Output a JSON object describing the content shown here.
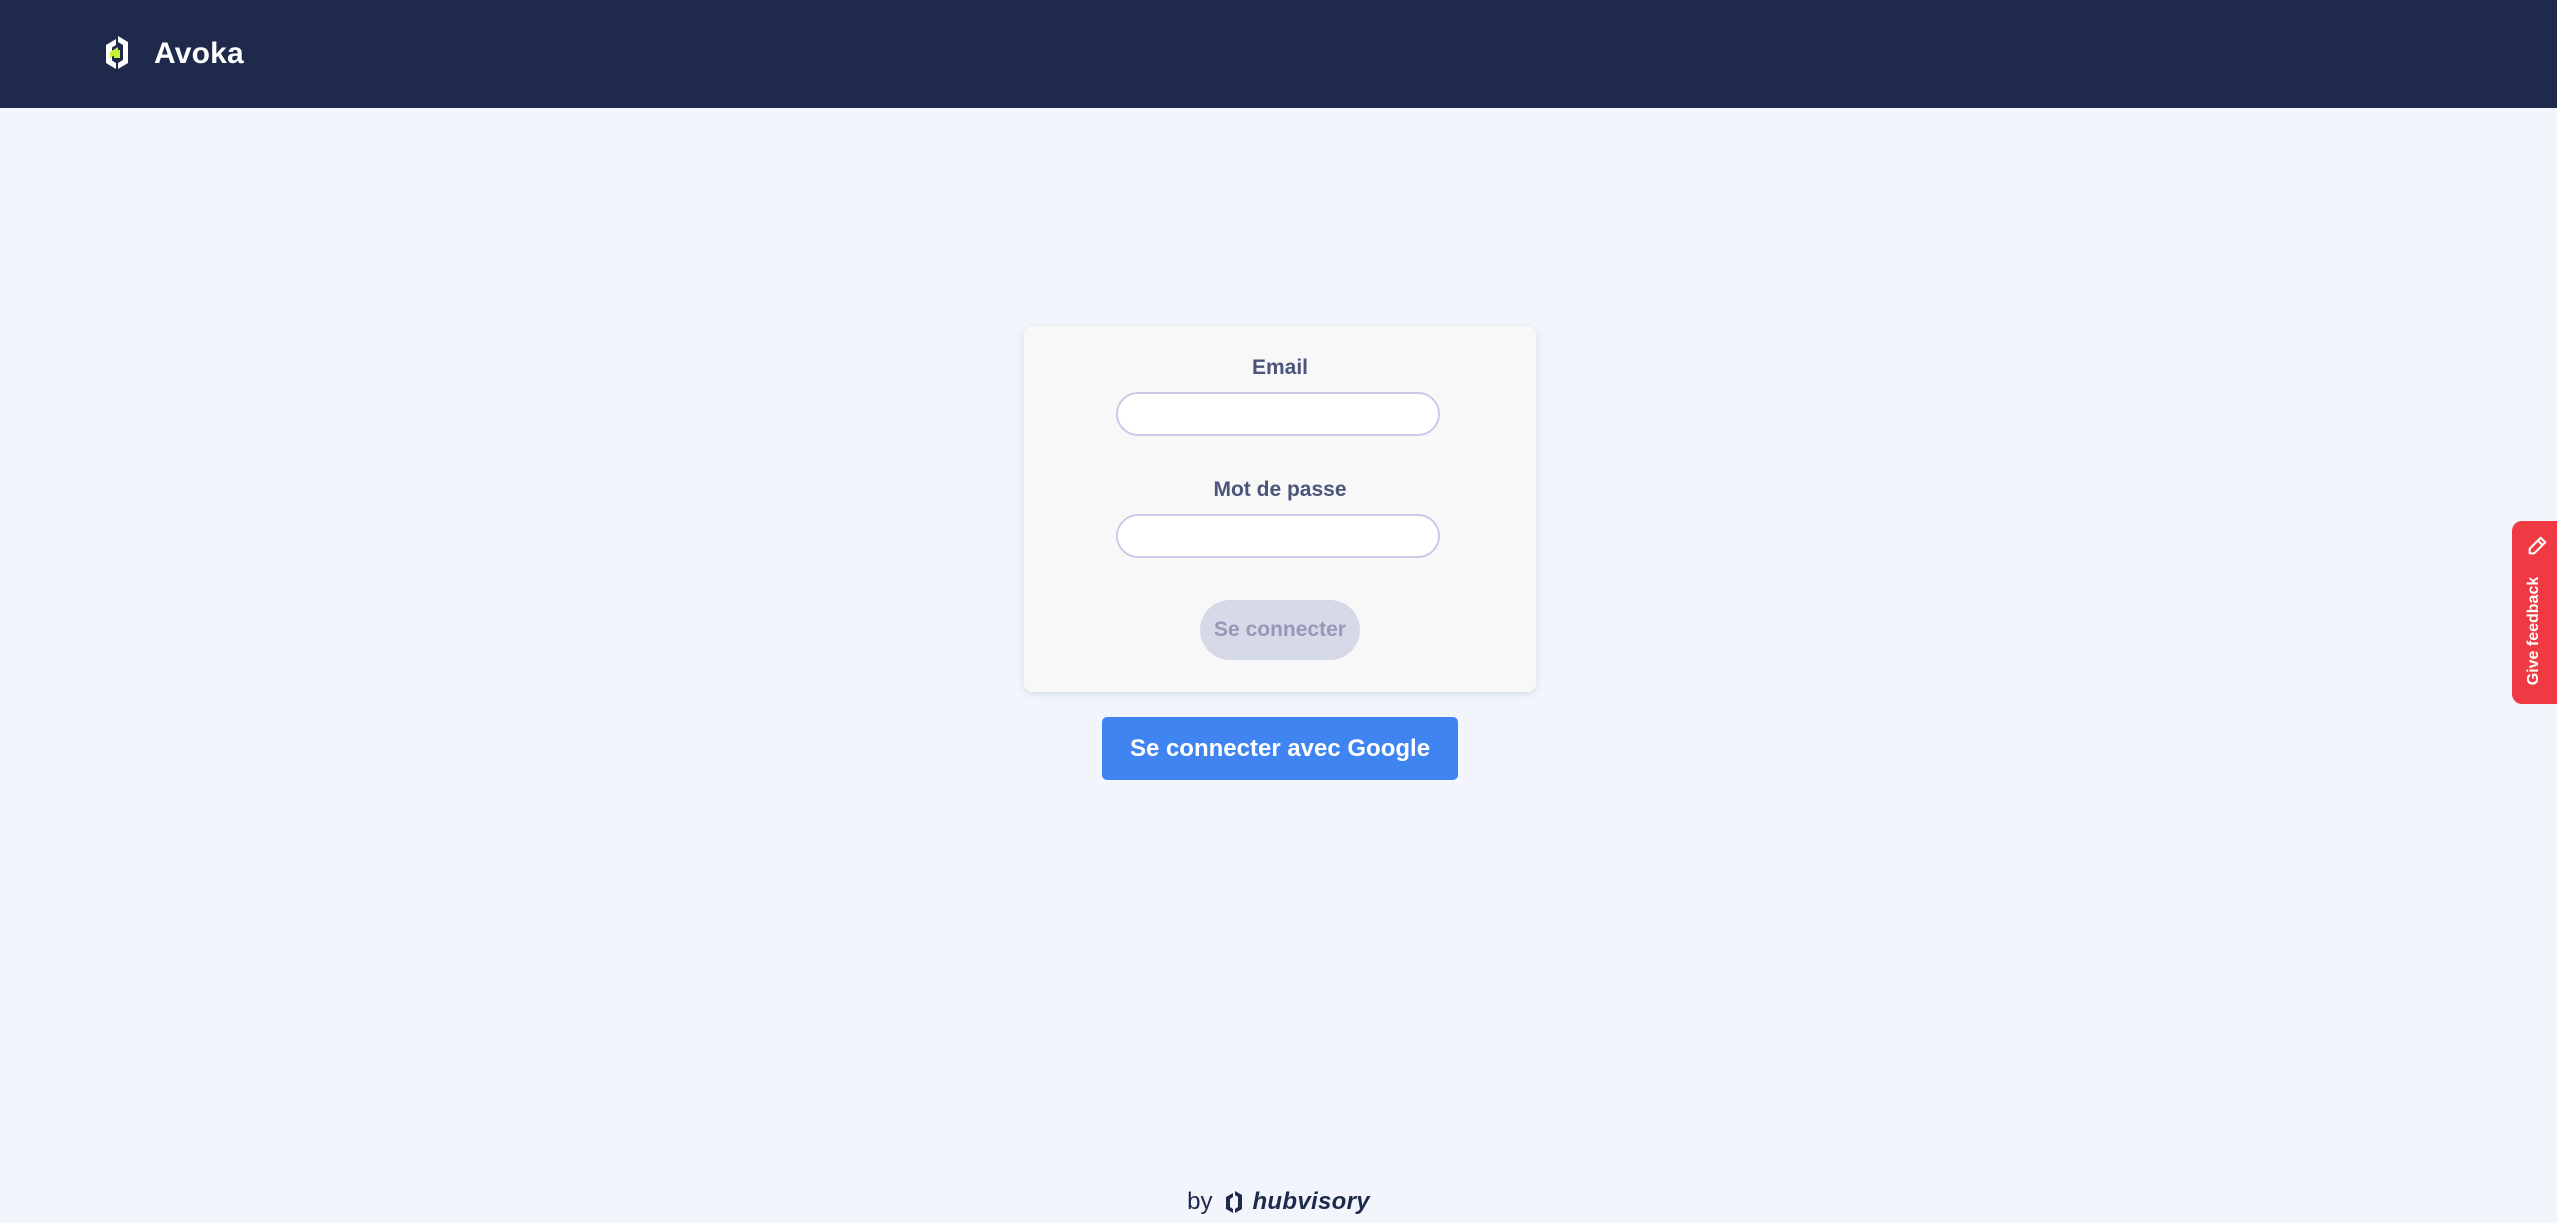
{
  "header": {
    "app_name": "Avoka",
    "logo_icon": "avoka-logo-icon",
    "background_color": "#1f294c",
    "accent_color": "#c6f432"
  },
  "login_form": {
    "email_label": "Email",
    "email_value": "",
    "password_label": "Mot de passe",
    "password_value": "",
    "submit_label": "Se connecter",
    "submit_state": "disabled"
  },
  "google_button": {
    "label": "Se connecter avec Google",
    "color": "#3f84f1"
  },
  "feedback": {
    "label": "Give feedback",
    "icon": "pencil-icon",
    "color": "#f03a43"
  },
  "footer": {
    "by_text": "by",
    "company_name": "hubvisory",
    "logo_icon": "hubvisory-logo-icon"
  }
}
